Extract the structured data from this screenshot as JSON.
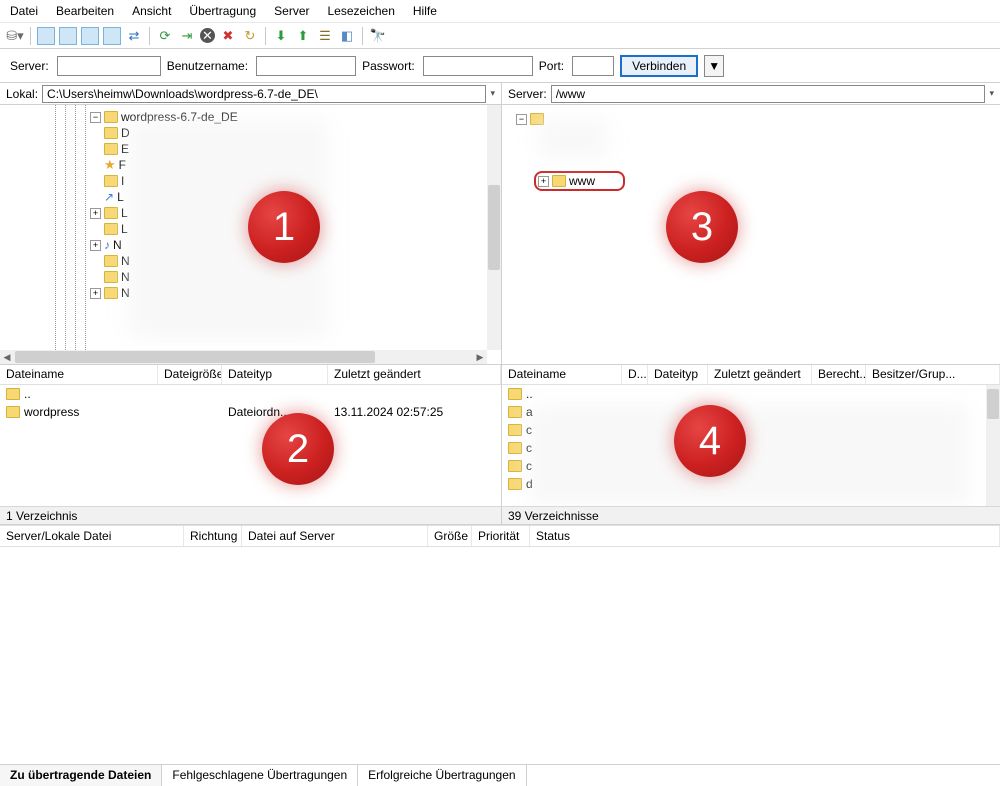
{
  "menu": {
    "items": [
      "Datei",
      "Bearbeiten",
      "Ansicht",
      "Übertragung",
      "Server",
      "Lesezeichen",
      "Hilfe"
    ]
  },
  "quickconnect": {
    "server_label": "Server:",
    "user_label": "Benutzername:",
    "pass_label": "Passwort:",
    "port_label": "Port:",
    "connect_label": "Verbinden"
  },
  "local": {
    "label": "Lokal:",
    "path": "C:\\Users\\heimw\\Downloads\\wordpress-6.7-de_DE\\",
    "tree_root": "wordpress-6.7-de_DE",
    "tree_letters": [
      "D",
      "E",
      "F",
      "I",
      "L",
      "L",
      "L",
      "N",
      "N",
      "N",
      "N"
    ],
    "list": {
      "cols": [
        "Dateiname",
        "Dateigröße",
        "Dateityp",
        "Zuletzt geändert"
      ],
      "up": "..",
      "rows": [
        {
          "name": "wordpress",
          "size": "",
          "type": "Dateiordn...",
          "modified": "13.11.2024 02:57:25"
        }
      ],
      "footer": "1 Verzeichnis"
    }
  },
  "remote": {
    "label": "Server:",
    "path": "/www",
    "tree_www": "www",
    "list": {
      "cols": [
        "Dateiname",
        "D...",
        "Dateityp",
        "Zuletzt geändert",
        "Berecht...",
        "Besitzer/Grup..."
      ],
      "up": "..",
      "footer": "39 Verzeichnisse"
    }
  },
  "queue": {
    "cols": [
      "Server/Lokale Datei",
      "Richtung",
      "Datei auf Server",
      "Größe",
      "Priorität",
      "Status"
    ]
  },
  "tabs": [
    "Zu übertragende Dateien",
    "Fehlgeschlagene Übertragungen",
    "Erfolgreiche Übertragungen"
  ],
  "badges": [
    "1",
    "2",
    "3",
    "4"
  ]
}
